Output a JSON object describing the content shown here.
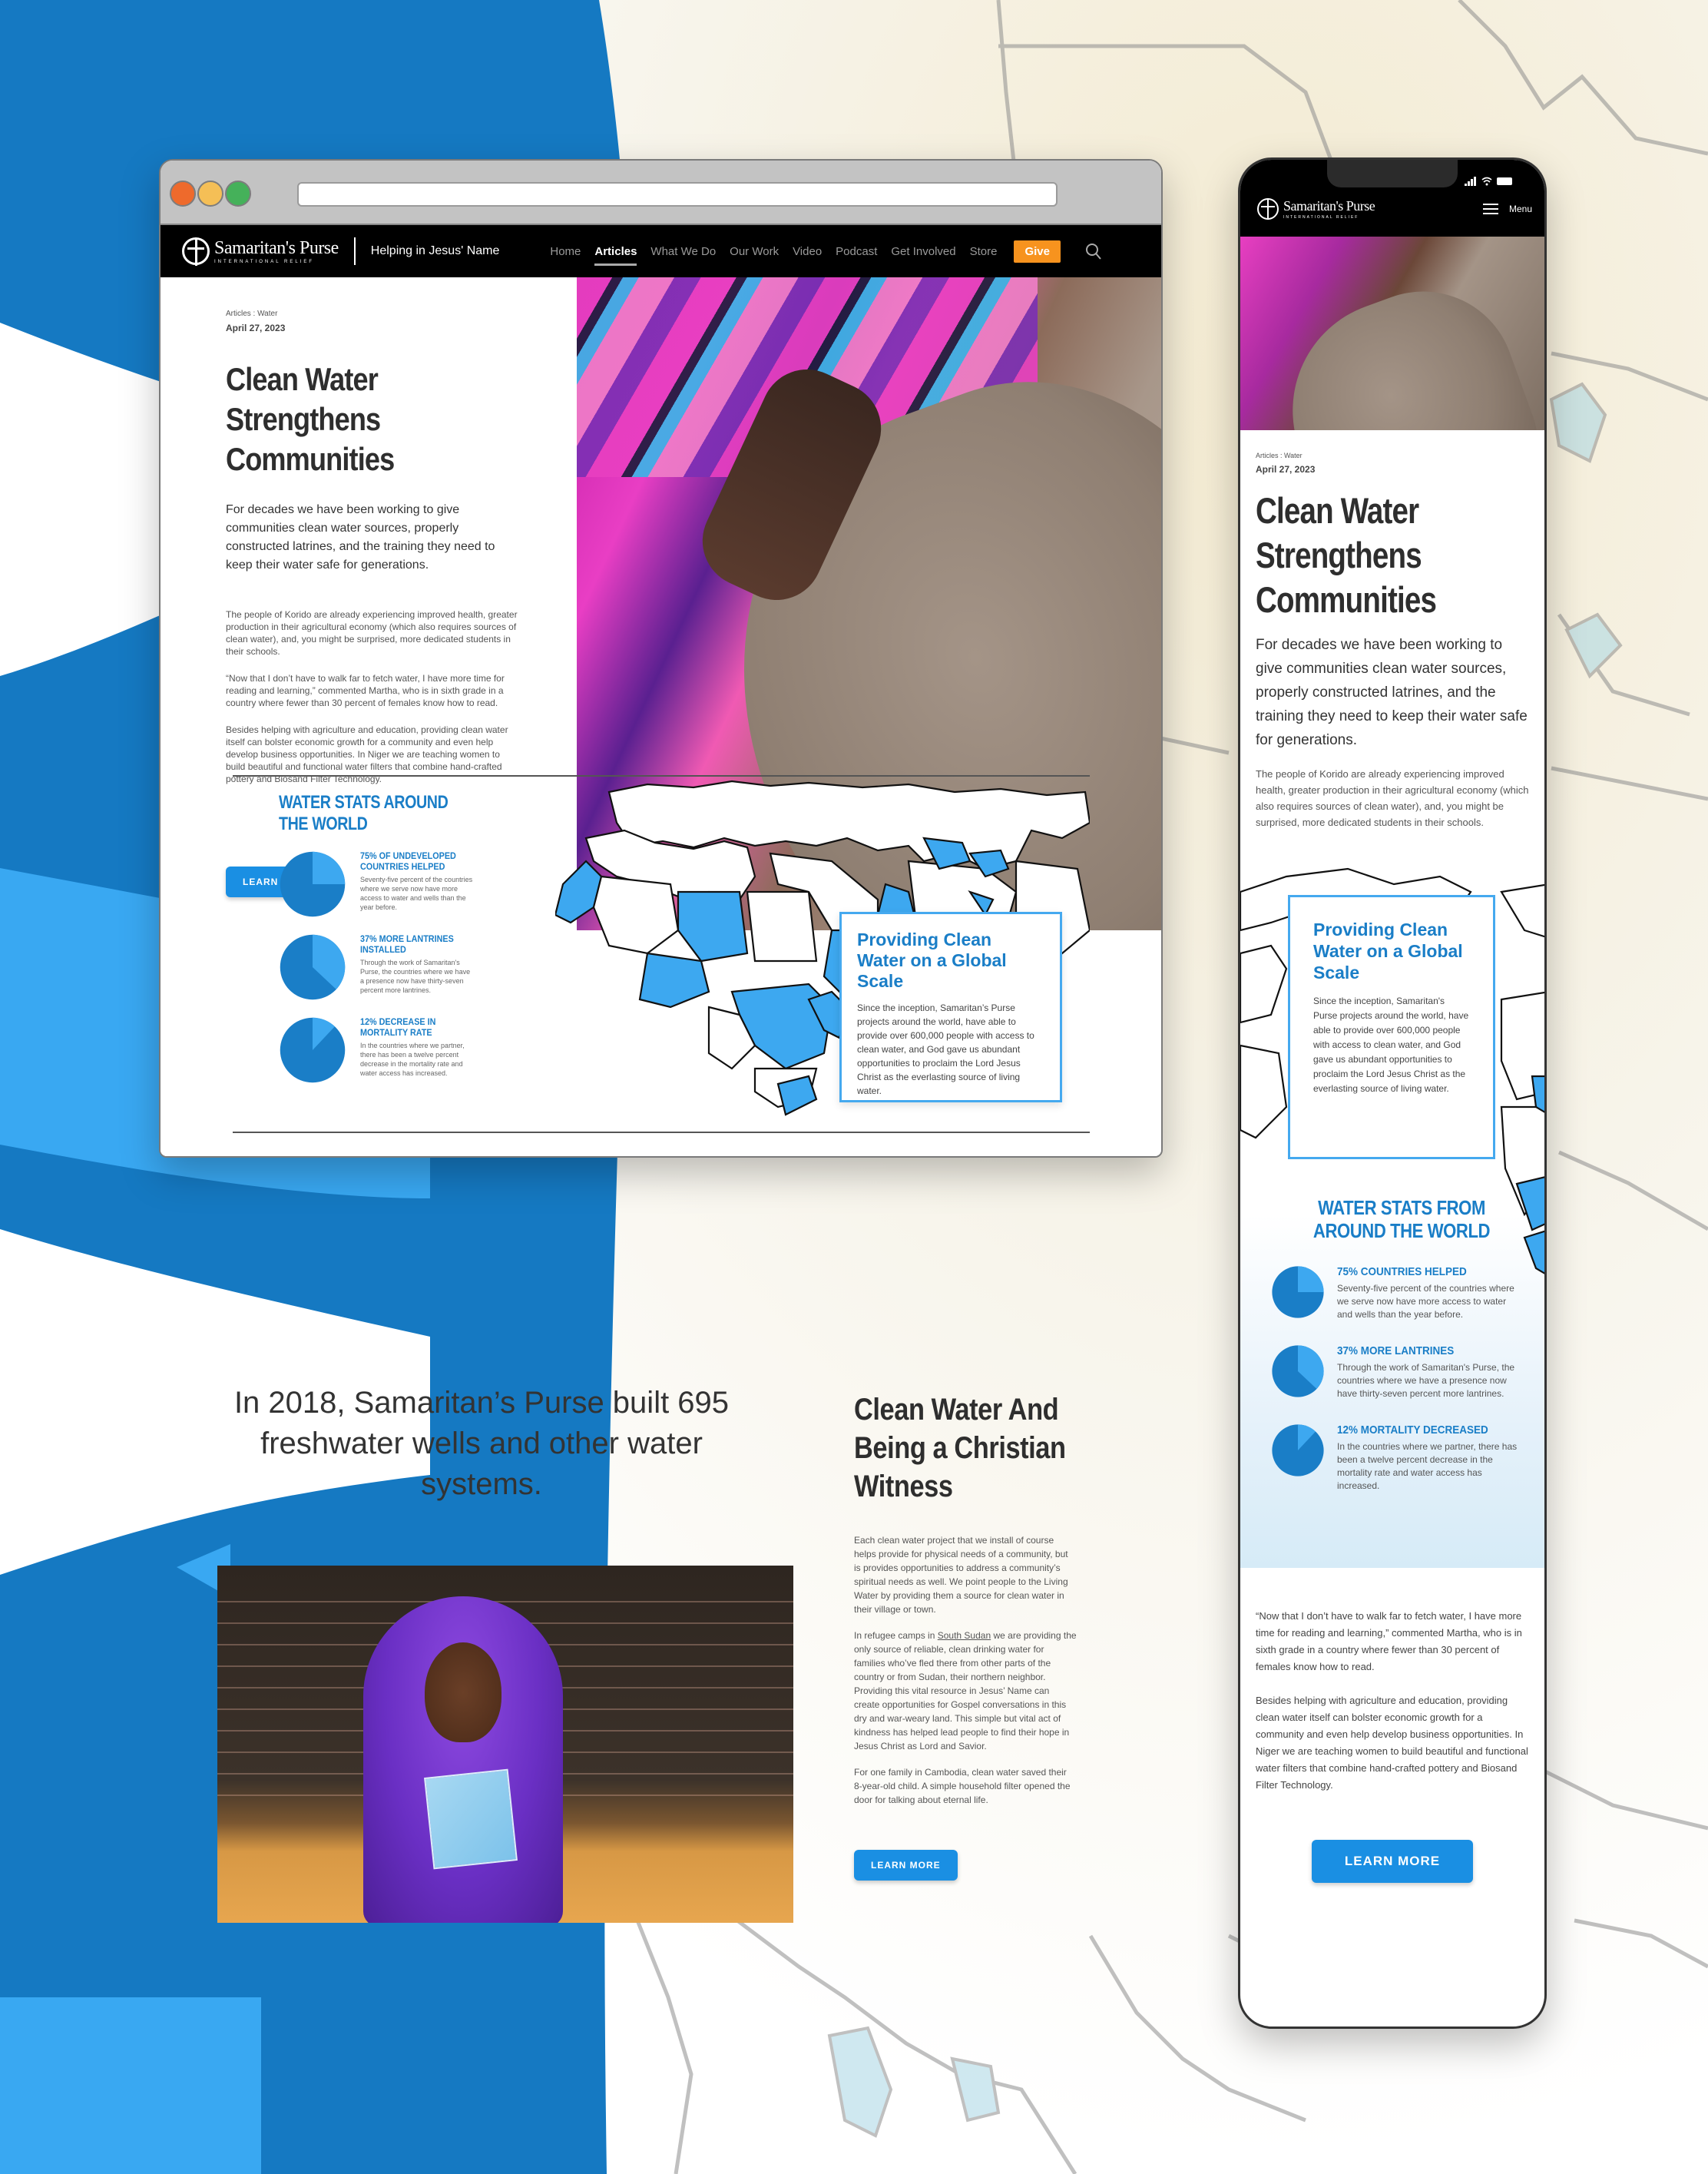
{
  "browser": {
    "nav": {
      "brand": "Samaritan's Purse",
      "brand_sub": "INTERNATIONAL RELIEF",
      "tagline": "Helping in Jesus' Name",
      "links": [
        "Home",
        "Articles",
        "What We Do",
        "Our Work",
        "Video",
        "Podcast",
        "Get Involved",
        "Store"
      ],
      "active_link": "Articles",
      "give_label": "Give",
      "search_icon": "search-icon"
    },
    "hero": {
      "breadcrumb": "Articles : Water",
      "date": "April 27, 2023",
      "title": "Clean Water Strengthens Communities",
      "lede": "For decades we have been working to give communities clean water sources, properly constructed latrines, and the training they need to keep their water safe for generations.",
      "paragraphs": [
        "The people of Korido are already experiencing improved health, greater production in their agricultural economy (which also requires sources of clean water), and, you might be surprised, more dedicated students in their schools.",
        "“Now that I don’t have to walk far to fetch water, I have more time for reading and learning,” commented Martha, who is in sixth grade in a country where fewer than 30 percent of females know how to read.",
        "Besides helping with agriculture and education, providing clean water itself can bolster economic growth for a community and even help develop business opportunities. In Niger we are teaching women to build beautiful and functional water filters that combine hand-crafted pottery and Biosand Filter Technology."
      ],
      "button": "LEARN MORE"
    },
    "stats": {
      "title": "WATER STATS AROUND THE WORLD",
      "items": [
        {
          "head": "75% OF UNDEVELOPED COUNTRIES HELPED",
          "desc": "Seventy-five percent of the countries where we serve now have more access to water and wells than the year before.",
          "percent": 75
        },
        {
          "head": "37% MORE LANTRINES INSTALLED",
          "desc": "Through the work of Samaritan's Purse, the countries where we have a presence now have thirty-seven percent more lantrines.",
          "percent": 37
        },
        {
          "head": "12% DECREASE IN MORTALITY RATE",
          "desc": "In the countries where we partner, there has been a twelve percent decrease in the mortality rate and water access has increased.",
          "percent": 12
        }
      ]
    },
    "global": {
      "title": "Providing Clean Water on a Global Scale",
      "body": "Since the inception, Samaritan’s Purse projects around the world, have able to provide over 600,000 people with access to clean water, and God gave us abundant opportunities to proclaim the Lord Jesus Christ as the everlasting source of living water."
    },
    "quote": "In 2018, Samaritan’s Purse built 695 freshwater wells and other water systems.",
    "witness": {
      "title": "Clean Water And Being a Christian Witness",
      "p1": "Each clean water project that we install of course helps provide for physical needs of a community, but is provides opportunities to address a community’s spiritual needs as well. We point people to the Living Water by providing them a source for clean water in their village or town.",
      "p2_before": "In refugee camps in ",
      "p2_link": "South Sudan",
      "p2_after": " we are providing the only source of reliable, clean drinking water for families who’ve fled there from other parts of the country or from Sudan, their northern neighbor. Providing this vital resource in Jesus’ Name can create opportunities for Gospel conversations in this dry and war-weary land. This simple but vital act of kindness has helped lead people to find their hope in Jesus Christ as Lord and Savior.",
      "p3": "For one family in Cambodia, clean water saved their 8-year-old child. A simple household filter opened the door for talking about eternal life.",
      "button": "LEARN MORE"
    }
  },
  "phone": {
    "brand": "Samaritan's Purse",
    "brand_sub": "INTERNATIONAL RELIEF",
    "menu_label": "Menu",
    "breadcrumb": "Articles : Water",
    "date": "April 27, 2023",
    "title": "Clean Water Strengthens Communities",
    "lede": "For decades we have been working to give communities clean water sources, properly constructed latrines, and the training they need to keep their water safe for generations.",
    "intro": "The people of Korido are already experiencing improved health, greater production in their agricultural economy (which also requires sources of clean water), and, you might be surprised, more dedicated students in their schools.",
    "global": {
      "title": "Providing Clean Water on a Global Scale",
      "body": "Since the inception, Samaritan's Purse projects around the world, have able to provide over 600,000 people with access to clean water, and God gave us abundant opportunities to proclaim the Lord Jesus Christ as the everlasting source of living water."
    },
    "stats": {
      "title": "WATER STATS FROM AROUND THE WORLD",
      "items": [
        {
          "head": "75% COUNTRIES HELPED",
          "desc": "Seventy-five percent of the countries where we serve now have more access to water and wells than the year before.",
          "percent": 75
        },
        {
          "head": "37% MORE LANTRINES",
          "desc": "Through the work of Samaritan's Purse, the countries where we have a presence now have thirty-seven percent more lantrines.",
          "percent": 37
        },
        {
          "head": "12% MORTALITY DECREASED",
          "desc": "In the countries where we partner, there has been a twelve percent decrease in the mortality rate and water access has increased.",
          "percent": 12
        }
      ]
    },
    "paragraphs": [
      "“Now that I don’t have to walk far to fetch water, I have more time for reading and learning,” commented Martha, who is in sixth grade in a country where fewer than 30 percent of females know how to read.",
      "Besides helping with agriculture and education, providing clean water itself can bolster economic growth for a community and even help develop business opportunities. In Niger we are teaching women to build beautiful and functional water filters that combine hand-crafted pottery and Biosand Filter Technology."
    ],
    "button": "LEARN MORE"
  },
  "colors": {
    "brand_blue": "#1a7ec7",
    "button_blue": "#1a8fe3",
    "highlight_blue": "#3da8f0",
    "give_orange": "#f7931e",
    "nav_black": "#000000"
  }
}
